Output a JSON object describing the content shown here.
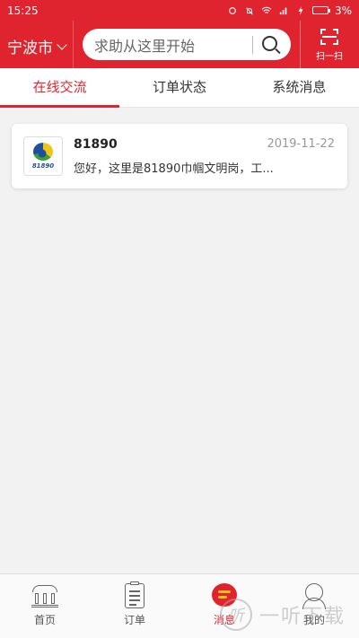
{
  "status_bar": {
    "time": "15:25",
    "battery": "3%"
  },
  "header": {
    "city": "宁波市",
    "search_placeholder": "求助从这里开始",
    "scan_label": "扫一扫"
  },
  "tabs": [
    {
      "label": "在线交流",
      "active": true
    },
    {
      "label": "订单状态",
      "active": false
    },
    {
      "label": "系统消息",
      "active": false
    }
  ],
  "conversations": [
    {
      "name": "81890",
      "date": "2019-11-22",
      "preview": "您好，这里是81890巾帼文明岗，工...",
      "logo_text": "81890"
    }
  ],
  "bottom_nav": [
    {
      "label": "首页",
      "icon": "home-icon",
      "active": false
    },
    {
      "label": "订单",
      "icon": "order-icon",
      "active": false
    },
    {
      "label": "消息",
      "icon": "message-icon",
      "active": true
    },
    {
      "label": "我的",
      "icon": "profile-icon",
      "active": false
    }
  ],
  "watermark": {
    "text": "一听下载"
  },
  "colors": {
    "brand_red": "#e0242f",
    "accent_yellow": "#f7c019"
  }
}
